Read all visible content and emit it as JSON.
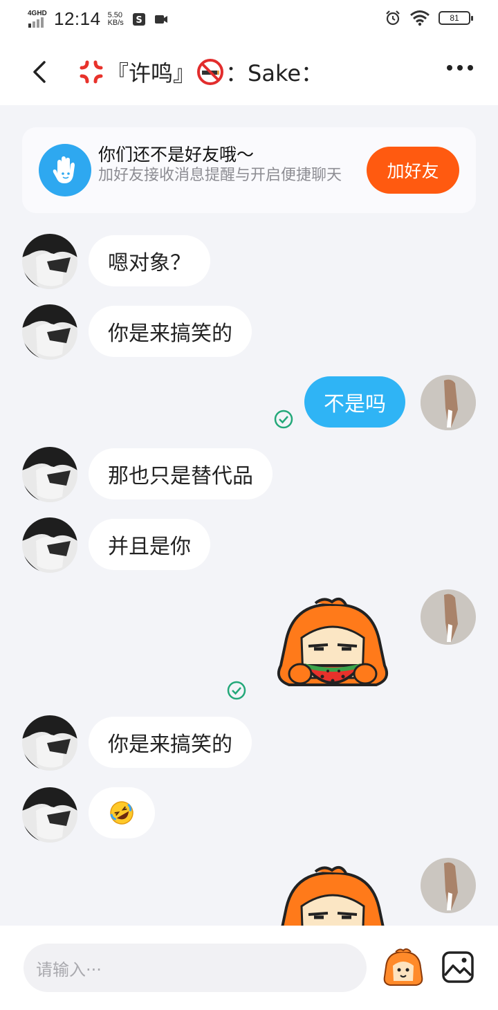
{
  "status_bar": {
    "network": "4GHD",
    "time": "12:14",
    "speed_value": "5.50",
    "speed_unit": "KB/s",
    "battery": "81"
  },
  "header": {
    "title_prefix": "『许鸣』",
    "title_suffix": "：Sake："
  },
  "friend_notice": {
    "title": "你们还不是好友哦～",
    "subtitle": "加好友接收消息提醒与开启便捷聊天",
    "button": "加好友"
  },
  "messages": [
    {
      "from": "other",
      "text": "嗯对象？"
    },
    {
      "from": "other",
      "text": "你是来搞笑的"
    },
    {
      "from": "me",
      "text": "不是吗"
    },
    {
      "from": "other",
      "text": "那也只是替代品"
    },
    {
      "from": "other",
      "text": "并且是你"
    },
    {
      "from": "me",
      "sticker": "watermelon-sticker"
    },
    {
      "from": "other",
      "text": "你是来搞笑的"
    },
    {
      "from": "other",
      "emoji": "rolling-laugh-emoji"
    },
    {
      "from": "me",
      "sticker": "mascot-sticker"
    }
  ],
  "input": {
    "placeholder": "请输入···"
  },
  "colors": {
    "accent_orange": "#ff5a10",
    "bubble_blue": "#2fb4f5",
    "icon_blue": "#2ea8f0",
    "background": "#f3f4f8",
    "check_green": "#23a879"
  }
}
